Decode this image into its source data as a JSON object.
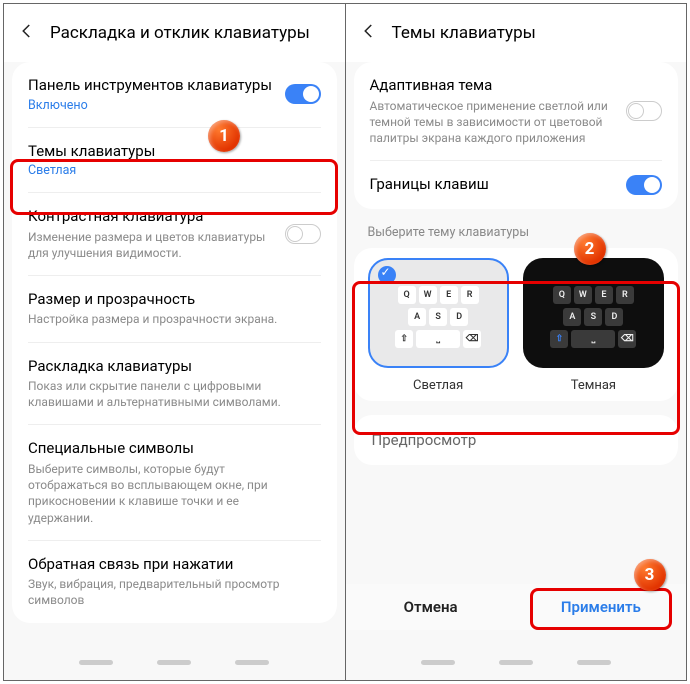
{
  "left": {
    "title": "Раскладка и отклик клавиатуры",
    "toolbar": {
      "title": "Панель инструментов клавиатуры",
      "state": "Включено"
    },
    "themes": {
      "title": "Темы клавиатуры",
      "value": "Светлая"
    },
    "contrast": {
      "title": "Контрастная клавиатура",
      "sub": "Изменение размера и цветов клавиатуры для улучшения видимости."
    },
    "size": {
      "title": "Размер и прозрачность",
      "sub": "Настройка размера и прозрачности экрана."
    },
    "layout": {
      "title": "Раскладка клавиатуры",
      "sub": "Показ или скрытие панели с цифровыми клавишами и альтернативными символами."
    },
    "symbols": {
      "title": "Специальные символы",
      "sub": "Выберите символы, которые будут отображаться во всплывающем окне, при прикосновении к клавише точки и ее удержании."
    },
    "feedback": {
      "title": "Обратная связь при нажатии",
      "sub": "Звук, вибрация, предварительный просмотр символов"
    }
  },
  "right": {
    "title": "Темы клавиатуры",
    "adaptive": {
      "title": "Адаптивная тема",
      "sub": "Автоматическое применение светлой или темной темы в зависимости от цветовой палитры экрана каждого приложения"
    },
    "borders": {
      "title": "Границы клавиш"
    },
    "select_label": "Выберите тему клавиатуры",
    "theme_light": "Светлая",
    "theme_dark": "Темная",
    "preview": "Предпросмотр",
    "cancel": "Отмена",
    "apply": "Применить"
  },
  "keys": {
    "r1": [
      "Q",
      "W",
      "E",
      "R"
    ],
    "r2": [
      "A",
      "S",
      "D"
    ]
  },
  "callouts": {
    "c1": "1",
    "c2": "2",
    "c3": "3"
  }
}
